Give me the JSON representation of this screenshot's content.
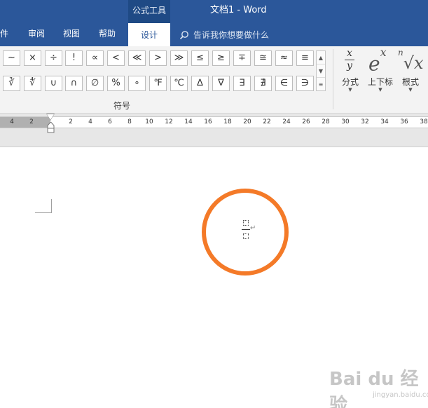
{
  "window": {
    "context_tab_title": "公式工具",
    "doc_title": "文档1  -  Word"
  },
  "ribbon_tabs": [
    {
      "label": "件"
    },
    {
      "label": "审阅"
    },
    {
      "label": "视图"
    },
    {
      "label": "帮助"
    },
    {
      "label": "设计",
      "active": true
    }
  ],
  "tell_me": {
    "placeholder": "告诉我你想要做什么"
  },
  "symbols": {
    "row1": [
      "~",
      "×",
      "÷",
      "!",
      "∝",
      "<",
      "≪",
      ">",
      "≫",
      "≤",
      "≥",
      "∓",
      "≅",
      "≈",
      "≡"
    ],
    "row2": [
      "∛",
      "∜",
      "∪",
      "∩",
      "∅",
      "%",
      "∘",
      "℉",
      "℃",
      "∆",
      "∇",
      "∃",
      "∄",
      "∈",
      "∋"
    ],
    "group_label": "符号",
    "scroll": [
      "▲",
      "▼",
      "≡"
    ]
  },
  "structures": {
    "fraction": {
      "label": "分式",
      "num": "x",
      "den": "y"
    },
    "script": {
      "label": "上下标",
      "base": "e",
      "sup": "x"
    },
    "radical": {
      "label": "根式",
      "index": "n",
      "body": "√x"
    }
  },
  "ruler": {
    "left_labels": [
      "4",
      "2"
    ],
    "right_labels": [
      "2",
      "4",
      "6",
      "8",
      "10",
      "12",
      "14",
      "16",
      "18",
      "20",
      "22",
      "24",
      "26",
      "28",
      "30",
      "32",
      "34",
      "36",
      "38"
    ]
  },
  "document": {
    "paragraph_mark": "↵"
  },
  "watermark": {
    "logo": "Bai du 经验",
    "sub": "jingyan.baidu.com"
  },
  "colors": {
    "title_bar": "#2b579a",
    "context_tab": "#1f4a85",
    "highlight_circle": "#f47a28"
  }
}
